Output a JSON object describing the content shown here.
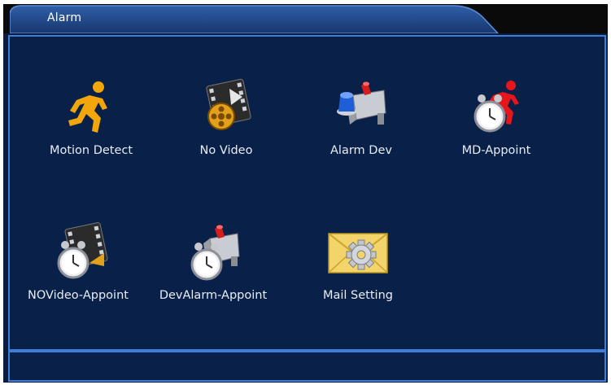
{
  "window": {
    "title": "Alarm"
  },
  "menu": {
    "items": [
      {
        "label": "Motion Detect",
        "icon": "running-man-icon"
      },
      {
        "label": "No Video",
        "icon": "video-film-icon"
      },
      {
        "label": "Alarm Dev",
        "icon": "alarm-siren-device-icon"
      },
      {
        "label": "MD-Appoint",
        "icon": "clock-running-man-icon"
      },
      {
        "label": "NOVideo-Appoint",
        "icon": "clock-film-icon"
      },
      {
        "label": "DevAlarm-Appoint",
        "icon": "clock-alarm-device-icon"
      },
      {
        "label": "Mail Setting",
        "icon": "mail-gear-icon"
      }
    ]
  },
  "colors": {
    "panel_bg": "#092048",
    "border": "#3d7ed8",
    "motion_yellow": "#f2a60c",
    "md_red": "#e5161c"
  }
}
